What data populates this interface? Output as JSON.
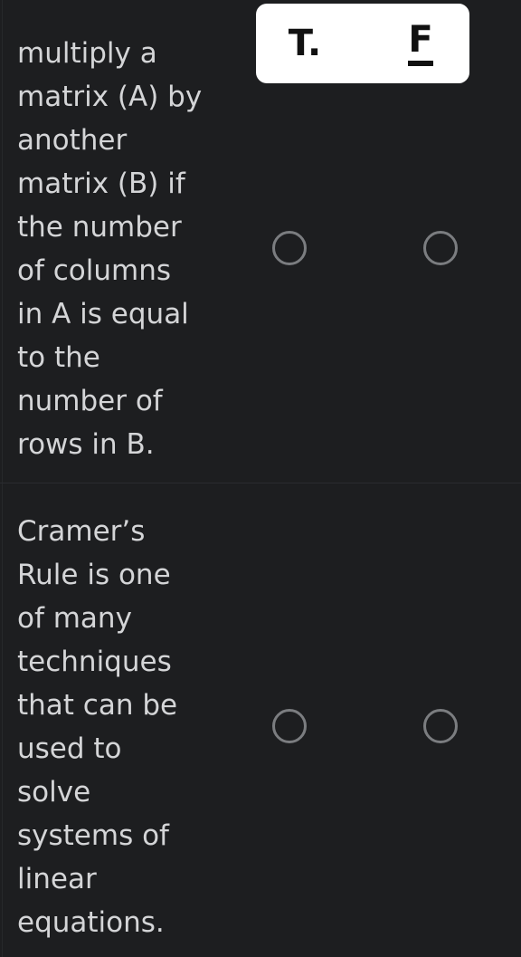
{
  "theme": {
    "background": "#1d1e20",
    "text_color": "#d4d5d7",
    "header_background": "#ffffff",
    "header_text_color": "#111111",
    "radio_outline": "#7b7d80",
    "divider": "#2a2c2f"
  },
  "header": {
    "true_label": "T.",
    "false_label": "F"
  },
  "questions": [
    {
      "text": "multiply a matrix (A) by another matrix (B) if the number of columns in A is equal to the number of rows in B.",
      "options": [
        {
          "name": "true",
          "selected": false
        },
        {
          "name": "false",
          "selected": false
        }
      ]
    },
    {
      "text": "Cramer’s Rule is one of many techniques that can be used to solve systems of linear equations.",
      "options": [
        {
          "name": "true",
          "selected": false
        },
        {
          "name": "false",
          "selected": false
        }
      ]
    }
  ]
}
